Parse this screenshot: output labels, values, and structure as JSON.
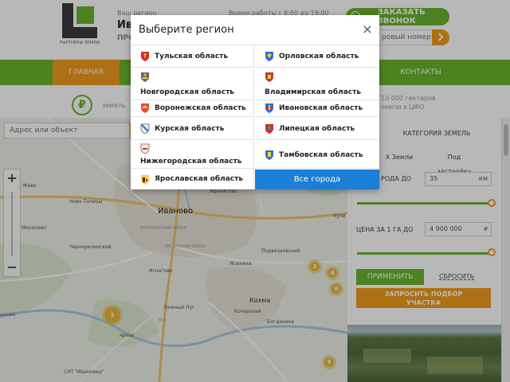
{
  "header": {
    "logo_text": "ПАРТНЕРЫ ЗЕМЛИ",
    "region_caption": "Ваш регион",
    "region_name": "Ива",
    "tagline": "ПРО ГА",
    "hours": "Время работы с 8:00 до 19:00",
    "callback_label": "ЗАКАЗАТЬ ЗВОНОК",
    "phone_placeholder": "ровый номер"
  },
  "nav": {
    "home": "ГЛАВНАЯ",
    "contacts": "КОНТАКТЫ"
  },
  "info": {
    "left": "земель",
    "right1": "10 000 гектаров",
    "right2": "земли в ЦФО"
  },
  "map": {
    "search_placeholder": "Адрес или объект",
    "zoom_in": "+",
    "zoom_out": "−",
    "labels": {
      "ivanovo": "Иваново",
      "kohma": "Кохма",
      "novo_talitsy": "Ново-Талицы",
      "mikhalevo": "Михалево",
      "chernorechensky": "Черноречинский",
      "ignatovo": "Игнатово",
      "lezhnevsky_lug": "Лежный Луг",
      "podvyaznovsky": "Подвязновский",
      "yasyunikha": "Ясюниха",
      "kochorsky": "Кочорский",
      "bogdanikha": "Богданиха",
      "afanasovo": "Афанасово",
      "snt": "СНТ \"Ивановец\"",
      "kuli": "Кули",
      "zhevo": "Жево",
      "yrevo": "ярево",
      "ykovo": "ыково",
      "frunzensky": "ФРУНЗЕНСКИЙ РАЙОН",
      "leninsky": "ЛЕНИНСКИЙ РАЙОН",
      "m7": "М-7"
    },
    "clusters": [
      "2",
      "4",
      "6",
      "8",
      "2"
    ]
  },
  "filters": {
    "category_tab": "КАТЕГОРИЯ ЗЕМЕЛЬ",
    "subtab_a": "Х Земли",
    "subtab_b": "Под застройку",
    "distance_label": "РОДА ДО",
    "distance_value": "35",
    "distance_unit": "КМ",
    "price_label": "ЦЕНА ЗА 1 ГА ДО",
    "price_value": "4 900 000",
    "price_unit": "₽",
    "apply": "ПРИМЕНИТЬ",
    "reset": "СБРОСИТЬ",
    "request_line1": "ЗАПРОСИТЬ ПОДБОР",
    "request_line2": "УЧАСТКА"
  },
  "modal": {
    "title": "Выберите регион",
    "close": "×",
    "regions": [
      {
        "name": "Тульская область",
        "icon": "tula-coat-of-arms-icon"
      },
      {
        "name": "Орловская область",
        "icon": "orel-coat-of-arms-icon"
      },
      {
        "name": "Новгородская область",
        "icon": "novgorod-coat-of-arms-icon"
      },
      {
        "name": "Владимирская область",
        "icon": "vladimir-coat-of-arms-icon"
      },
      {
        "name": "Воронежская область",
        "icon": "voronezh-coat-of-arms-icon"
      },
      {
        "name": "Ивановская область",
        "icon": "ivanovo-coat-of-arms-icon"
      },
      {
        "name": "Курская область",
        "icon": "kursk-coat-of-arms-icon"
      },
      {
        "name": "Липецкая область",
        "icon": "lipetsk-coat-of-arms-icon"
      },
      {
        "name": "Нижегородская область",
        "icon": "nizhny-novgorod-coat-of-arms-icon"
      },
      {
        "name": "Тамбовская область",
        "icon": "tambov-coat-of-arms-icon"
      },
      {
        "name": "Ярославская область",
        "icon": "yaroslavl-coat-of-arms-icon"
      }
    ],
    "all_cities": "Все города"
  },
  "colors": {
    "brand_green": "#6ab42d",
    "accent_orange": "#f29b1d",
    "selected_blue": "#1a7fd5",
    "cluster_yellow": "#e8b940"
  }
}
